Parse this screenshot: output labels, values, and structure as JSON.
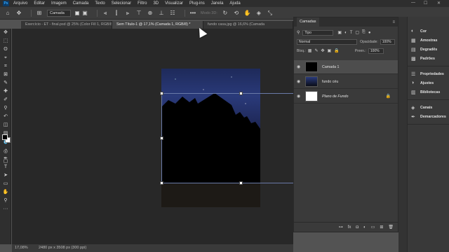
{
  "menubar": {
    "items": [
      "Arquivo",
      "Editar",
      "Imagem",
      "Camada",
      "Texto",
      "Selecionar",
      "Filtro",
      "3D",
      "Visualizar",
      "Plug-ins",
      "Janela",
      "Ajuda"
    ],
    "logo": "Ps"
  },
  "options": {
    "auto_select_label": "Camada",
    "mode_3d": "Modo 3D:"
  },
  "tabs": [
    {
      "label": "Exercício - ET - final.psd @ 25% (Color Fill 1, RGB/8*) *"
    },
    {
      "label": "Sem Título-1 @ 17,1% (Camada 1, RGB/8) *"
    },
    {
      "label": "fundo casa.jpg @ 16,6% (Camada"
    }
  ],
  "status": {
    "zoom": "17,08%",
    "doc_size": "2480 px x 3508 px (300 ppi)"
  },
  "layers_panel": {
    "title": "Camadas",
    "filter": "Tipo",
    "blend_mode": "Normal",
    "opacity_label": "Opacidade:",
    "opacity_value": "100%",
    "lock_label": "Bloq.:",
    "fill_label": "Preen.:",
    "fill_value": "100%",
    "layers": [
      {
        "name": "Camada 1",
        "selected": true,
        "italic": false
      },
      {
        "name": "fundo céu",
        "selected": false,
        "italic": false
      },
      {
        "name": "Plano de Fundo",
        "selected": false,
        "italic": true
      }
    ]
  },
  "dock": {
    "groups": [
      [
        {
          "icon": "color-wheel-icon",
          "label": "Cor"
        },
        {
          "icon": "swatches-icon",
          "label": "Amostras"
        },
        {
          "icon": "gradient-icon",
          "label": "Degradês"
        },
        {
          "icon": "pattern-icon",
          "label": "Padrões"
        }
      ],
      [
        {
          "icon": "properties-icon",
          "label": "Propriedades"
        },
        {
          "icon": "adjustments-icon",
          "label": "Ajustes"
        },
        {
          "icon": "library-icon",
          "label": "Bibliotecas"
        }
      ],
      [
        {
          "icon": "channels-icon",
          "label": "Canais"
        },
        {
          "icon": "paths-icon",
          "label": "Demarcadores"
        }
      ]
    ]
  }
}
